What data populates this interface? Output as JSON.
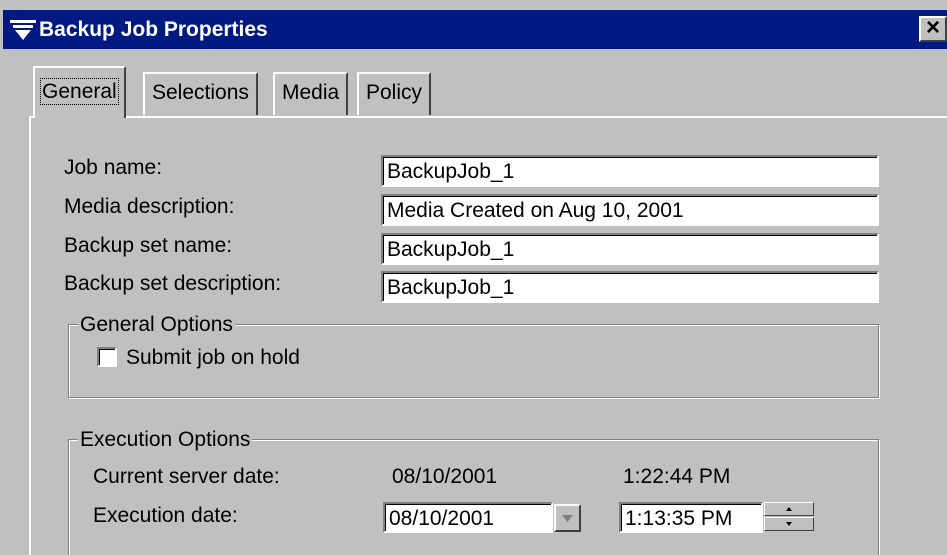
{
  "window": {
    "title": "Backup Job Properties",
    "close_symbol": "×"
  },
  "tabs": [
    {
      "label": "General",
      "active": true
    },
    {
      "label": "Selections",
      "active": false
    },
    {
      "label": "Media",
      "active": false
    },
    {
      "label": "Policy",
      "active": false
    }
  ],
  "form": {
    "job_name": {
      "label": "Job name:",
      "value": "BackupJob_1"
    },
    "media_description": {
      "label": "Media description:",
      "value": "Media Created on Aug 10, 2001"
    },
    "backup_set_name": {
      "label": "Backup set name:",
      "value": "BackupJob_1"
    },
    "backup_set_description": {
      "label": "Backup set description:",
      "value": "BackupJob_1"
    }
  },
  "general_options": {
    "title": "General Options",
    "submit_on_hold": {
      "label": "Submit job on hold",
      "checked": false
    }
  },
  "execution_options": {
    "title": "Execution Options",
    "current_server_date_label": "Current server date:",
    "current_server_date": "08/10/2001",
    "current_server_time": "1:22:44 PM",
    "execution_date_label": "Execution date:",
    "execution_date": "08/10/2001",
    "execution_time": "1:13:35 PM"
  },
  "icons": {
    "title_icon": "backup-funnel-icon",
    "dropdown": "triangle-down-icon",
    "spin_up": "triangle-up-icon",
    "spin_down": "triangle-down-icon"
  },
  "colors": {
    "titlebar": "#001a82",
    "window_face": "#c0c0c0"
  }
}
